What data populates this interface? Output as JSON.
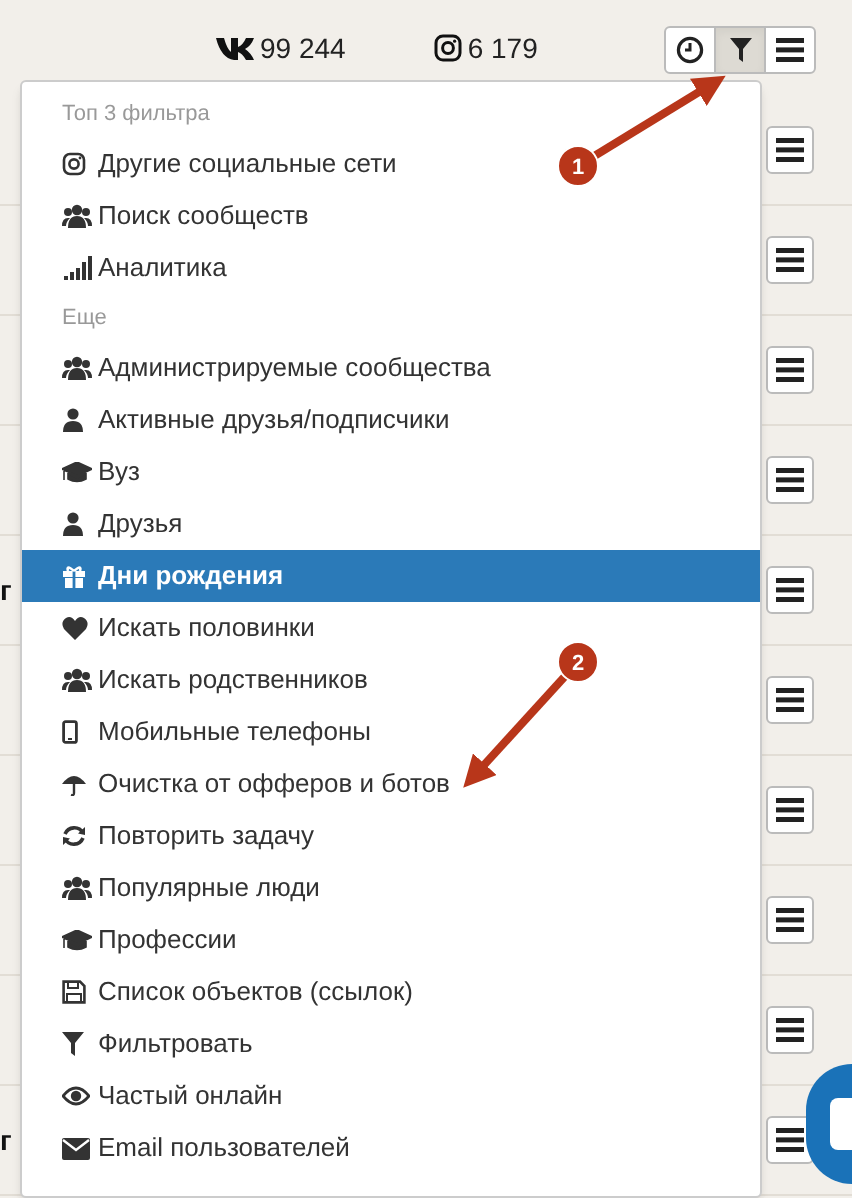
{
  "stats": [
    {
      "value": "99 244"
    },
    {
      "value": "6 179"
    }
  ],
  "toolbar": [
    {
      "selected": false
    },
    {
      "selected": true
    },
    {
      "selected": false
    }
  ],
  "rows": [
    {
      "text": ""
    },
    {
      "text": ""
    },
    {
      "text": ""
    },
    {
      "text": ""
    },
    {
      "text": "г"
    },
    {
      "text": ""
    },
    {
      "text": ""
    },
    {
      "text": ""
    },
    {
      "text": ""
    },
    {
      "text": "г"
    }
  ],
  "menu": {
    "sections": [
      {
        "heading": "Топ 3 фильтра",
        "items": [
          {
            "label": "Другие социальные сети",
            "selected": false
          },
          {
            "label": "Поиск сообществ",
            "selected": false
          },
          {
            "label": "Аналитика",
            "selected": false
          }
        ]
      },
      {
        "heading": "Еще",
        "items": [
          {
            "label": "Администрируемые сообщества",
            "selected": false
          },
          {
            "label": "Активные друзья/подписчики",
            "selected": false
          },
          {
            "label": "Вуз",
            "selected": false
          },
          {
            "label": "Друзья",
            "selected": false
          },
          {
            "label": "Дни рождения",
            "selected": true
          },
          {
            "label": "Искать половинки",
            "selected": false
          },
          {
            "label": "Искать родственников",
            "selected": false
          },
          {
            "label": "Мобильные телефоны",
            "selected": false
          },
          {
            "label": "Очистка от офферов и ботов",
            "selected": false
          },
          {
            "label": "Повторить задачу",
            "selected": false
          },
          {
            "label": "Популярные люди",
            "selected": false
          },
          {
            "label": "Профессии",
            "selected": false
          },
          {
            "label": "Список объектов (ссылок)",
            "selected": false
          },
          {
            "label": "Фильтровать",
            "selected": false
          },
          {
            "label": "Частый онлайн",
            "selected": false
          },
          {
            "label": "Email пользователей",
            "selected": false
          }
        ]
      }
    ]
  },
  "annotations": [
    {
      "label": "1"
    },
    {
      "label": "2"
    }
  ]
}
